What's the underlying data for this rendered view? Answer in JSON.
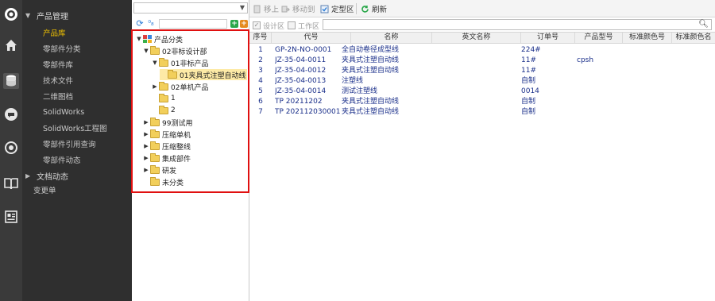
{
  "colors": {
    "rail_bg": "#3a3a3a",
    "nav_bg": "#2f2f2f",
    "nav_active": "#f2c300",
    "selection_bg": "#fdeaa6",
    "highlight_border": "#e01010",
    "grid_text": "#1a2f8a"
  },
  "icon_rail": [
    {
      "name": "logo-icon"
    },
    {
      "name": "home-icon"
    },
    {
      "name": "database-icon"
    },
    {
      "name": "chat-icon"
    },
    {
      "name": "broadcast-icon"
    },
    {
      "name": "book-icon"
    },
    {
      "name": "id-card-icon"
    }
  ],
  "nav": {
    "group1": "产品管理",
    "items": [
      "产品库",
      "零部件分类",
      "零部件库",
      "技术文件",
      "二维图档",
      "SolidWorks",
      "SolidWorks工程图",
      "零部件引用查询",
      "零部件动态"
    ],
    "group2": "文档动态",
    "plain": "变更单"
  },
  "tree": {
    "root": "产品分类",
    "nodes": [
      "02非标设计部",
      "01非标产品",
      "01夹具式注塑自动线",
      "02单机产品",
      "1",
      "2",
      "99测试用",
      "压缩单机",
      "压缩整线",
      "集成部件",
      "研发",
      "未分类"
    ]
  },
  "toolbar": {
    "move_up": "移上",
    "move_to": "移动到",
    "finalize": "定型区",
    "refresh": "刷新"
  },
  "filters": {
    "design": "设计区",
    "work": "工作区"
  },
  "grid": {
    "headers": [
      "序号",
      "代号",
      "名称",
      "英文名称",
      "订单号",
      "产品型号",
      "标准颜色号",
      "标准颜色名"
    ],
    "rows": [
      [
        "1",
        "GP-2N-NO-0001",
        "全自动卷径成型线",
        "",
        "224#",
        "",
        "",
        ""
      ],
      [
        "2",
        "JZ-35-04-0011",
        "夹具式注塑自动线",
        "",
        "11#",
        "cpsh",
        "",
        ""
      ],
      [
        "3",
        "JZ-35-04-0012",
        "夹具式注塑自动线",
        "",
        "11#",
        "",
        "",
        ""
      ],
      [
        "4",
        "JZ-35-04-0013",
        "注塑线",
        "",
        "自制",
        "",
        "",
        ""
      ],
      [
        "5",
        "JZ-35-04-0014",
        "测试注塑线",
        "",
        "0014",
        "",
        "",
        ""
      ],
      [
        "6",
        "TP 20211202",
        "夹具式注塑自动线",
        "",
        "自制",
        "",
        "",
        ""
      ],
      [
        "7",
        "TP 202112030001",
        "夹具式注塑自动线",
        "",
        "自制",
        "",
        "",
        ""
      ]
    ]
  }
}
